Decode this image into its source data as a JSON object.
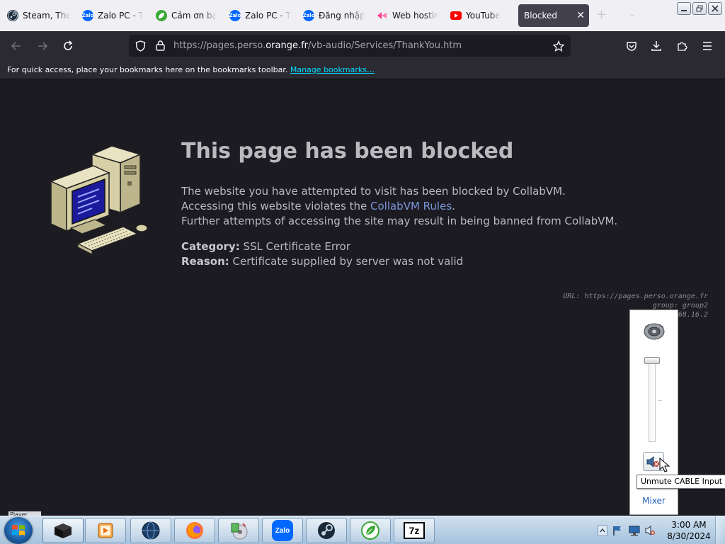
{
  "browser": {
    "tabs": [
      {
        "title": "Steam, The",
        "favicon": "steam-icon",
        "color": "#1b2838"
      },
      {
        "title": "Zalo PC - T",
        "favicon": "zalo-icon",
        "color": "#0068ff"
      },
      {
        "title": "Cảm ơn bạ",
        "favicon": "leaf-icon",
        "color": "#3aa935"
      },
      {
        "title": "Zalo PC - T",
        "favicon": "zalo-icon",
        "color": "#0068ff"
      },
      {
        "title": "Đăng nhập",
        "favicon": "zalo-icon",
        "color": "#0068ff"
      },
      {
        "title": "Web hostin",
        "favicon": "web-hosting-icon",
        "color": "#ff3d8b"
      },
      {
        "title": "YouTube",
        "favicon": "youtube-icon",
        "color": "#ff0000"
      },
      {
        "title": "Blocked",
        "favicon": "",
        "color": "#42414d"
      }
    ],
    "url": {
      "prefix": "https://pages.perso.",
      "host": "orange.fr",
      "path": "/vb-audio/Services/ThankYou.htm"
    },
    "bookmarks_bar": {
      "text": "For quick access, place your bookmarks here on the bookmarks toolbar.",
      "link": "Manage bookmarks…"
    }
  },
  "page": {
    "title": "This page has been blocked",
    "desc_line1": "The website you have attempted to visit has been blocked by CollabVM.",
    "desc_line2_pre": "Accessing this website violates the ",
    "desc_line2_link": "CollabVM Rules",
    "desc_line2_post": ".",
    "desc_line3": "Further attempts of accessing the site may result in being banned from CollabVM.",
    "category_label": "Category:",
    "category_value": "SSL Certificate Error",
    "reason_label": "Reason:",
    "reason_value": "Certificate supplied by server was not valid",
    "debug_url_label": "URL:",
    "debug_url_value": "https://pages.perso.orange.fr",
    "debug_group": "group: group2",
    "debug_ip": "68.16.2"
  },
  "volume_flyout": {
    "mixer_label": "Mixer",
    "tooltip": "Unmute CABLE Input",
    "level": 1.0
  },
  "taskbar": {
    "time": "3:00 AM",
    "date": "8/30/2024",
    "zalo_label": "Zalo",
    "sevenzip_label": "7z",
    "fragment_text": "Player"
  },
  "colors": {
    "page_bg": "#1c1b22",
    "toolbar_bg": "#2b2a33",
    "link_blue": "#7b95d8",
    "bookmark_link": "#00ddff"
  }
}
